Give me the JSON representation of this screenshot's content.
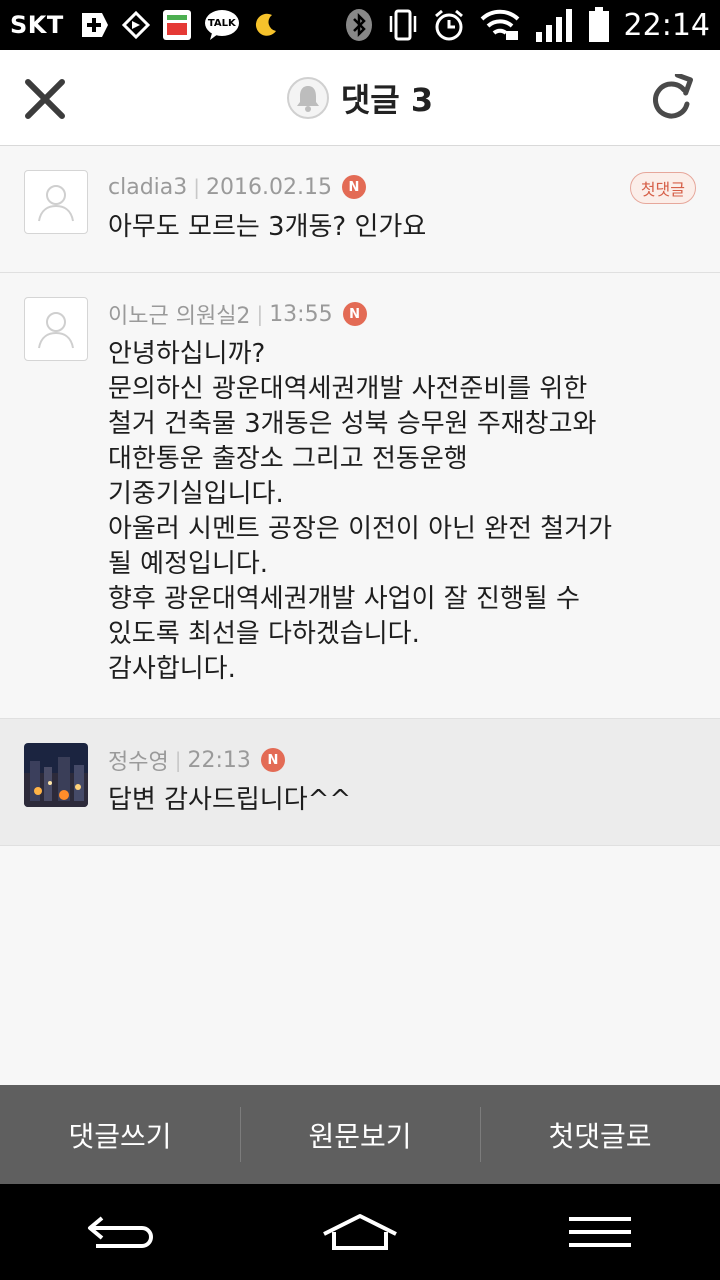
{
  "status_bar": {
    "carrier": "SKT",
    "kakao_label": "TALK",
    "time": "22:14",
    "icons": [
      "medical-cross-icon",
      "navigation-icon",
      "gift-app-icon",
      "kakaotalk-icon",
      "moon-icon",
      "bluetooth-icon",
      "vibrate-icon",
      "alarm-icon",
      "wifi-icon",
      "signal-icon",
      "battery-icon"
    ]
  },
  "header": {
    "title": "댓글 3",
    "icons": {
      "close": "close-icon",
      "bell": "bell-icon",
      "refresh": "refresh-icon"
    }
  },
  "comments": [
    {
      "author": "cladia3",
      "date": "2016.02.15",
      "new_badge": "N",
      "first_badge": "첫댓글",
      "text": "아무도 모르는 3개동? 인가요"
    },
    {
      "author": "이노근 의원실2",
      "date": "13:55",
      "new_badge": "N",
      "text": "안녕하십니까?\n문의하신 광운대역세권개발 사전준비를 위한\n철거 건축물 3개동은 성북 승무원 주재창고와\n대한통운 출장소 그리고 전동운행\n기중기실입니다.\n아울러 시멘트 공장은 이전이 아닌 완전 철거가\n될 예정입니다.\n향후 광운대역세권개발 사업이 잘 진행될 수\n있도록 최선을 다하겠습니다.\n감사합니다."
    },
    {
      "author": "정수영",
      "date": "22:13",
      "new_badge": "N",
      "text": "답변 감사드립니다^^"
    }
  ],
  "actions": {
    "write": "댓글쓰기",
    "view_original": "원문보기",
    "first_comment": "첫댓글로"
  },
  "nav": {
    "back": "back-icon",
    "home": "home-icon",
    "menu": "menu-icon"
  },
  "colors": {
    "new_badge": "#e36b55",
    "action_bar": "#5f5f5f",
    "highlight_row": "#ececec"
  }
}
